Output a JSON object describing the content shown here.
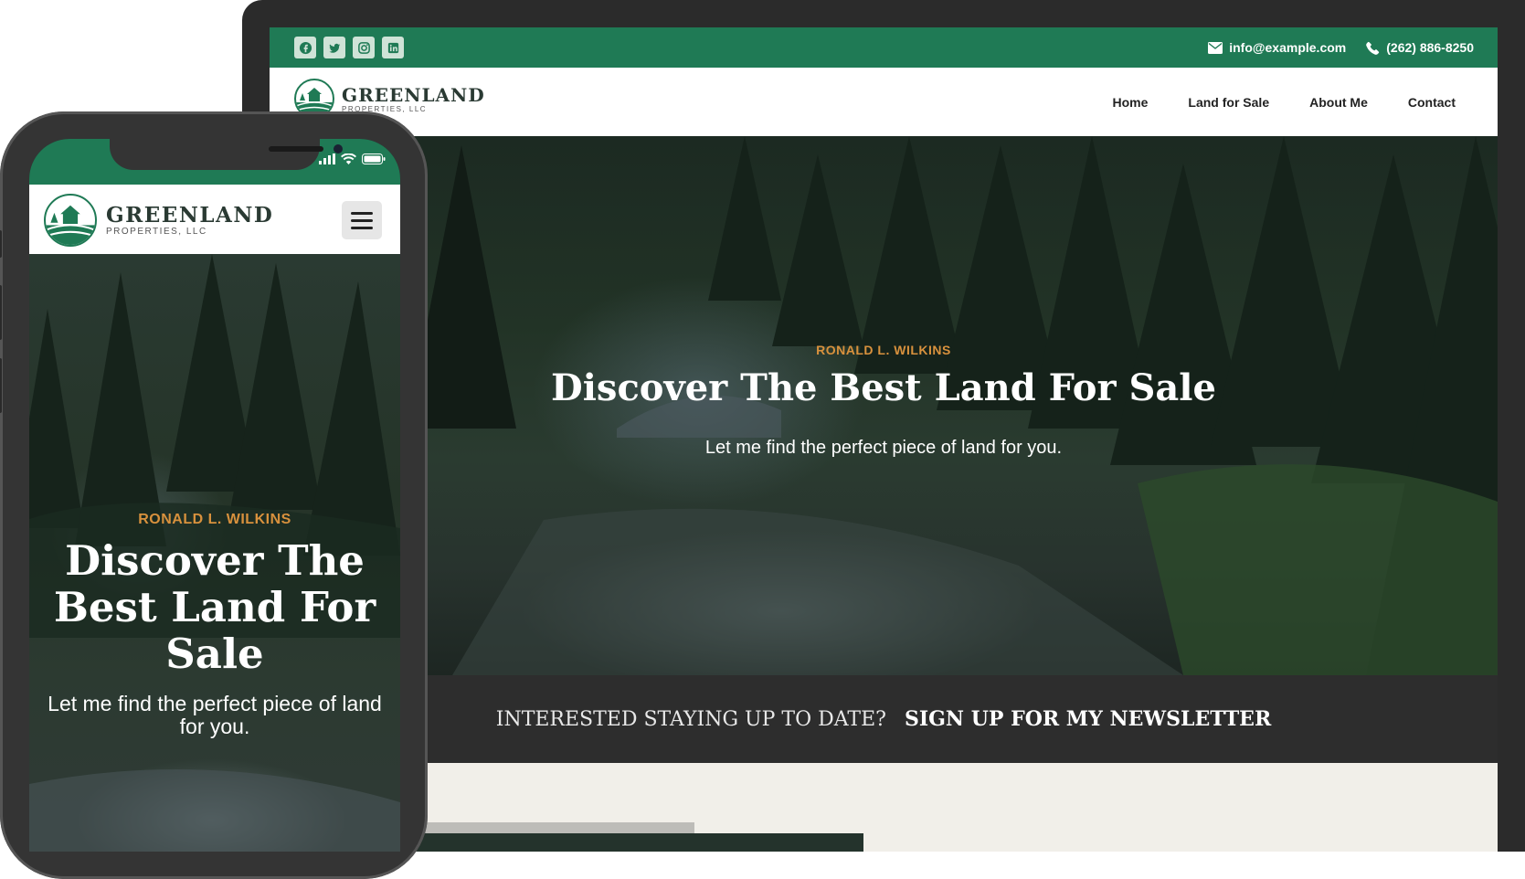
{
  "colors": {
    "brand_green": "#1f7a55",
    "accent_orange": "#d8913d",
    "dark_band": "#2d2d2d",
    "page_bg": "#f1efe9"
  },
  "desktop": {
    "topbar": {
      "social_icons": [
        "facebook-icon",
        "twitter-icon",
        "instagram-icon",
        "linkedin-icon"
      ],
      "email": "info@example.com",
      "phone": "(262) 886-8250"
    },
    "header": {
      "brand": "GREENLAND",
      "brand_sub": "PROPERTIES, LLC",
      "nav": [
        "Home",
        "Land for Sale",
        "About Me",
        "Contact"
      ]
    },
    "hero": {
      "eyebrow": "RONALD L. WILKINS",
      "title": "Discover The Best Land For Sale",
      "subtitle": "Let me find the perfect piece of land for you."
    },
    "newsletter": {
      "question": "INTERESTED STAYING UP TO DATE?",
      "cta": "SIGN UP FOR MY NEWSLETTER"
    }
  },
  "mobile": {
    "status_icons": [
      "signal-icon",
      "wifi-icon",
      "battery-icon"
    ],
    "header": {
      "brand": "GREENLAND",
      "brand_sub": "PROPERTIES, LLC",
      "menu_icon": "hamburger-menu-icon"
    },
    "hero": {
      "eyebrow": "RONALD L. WILKINS",
      "title": "Discover The Best Land For Sale",
      "subtitle": "Let me find the perfect piece of land for you."
    }
  }
}
